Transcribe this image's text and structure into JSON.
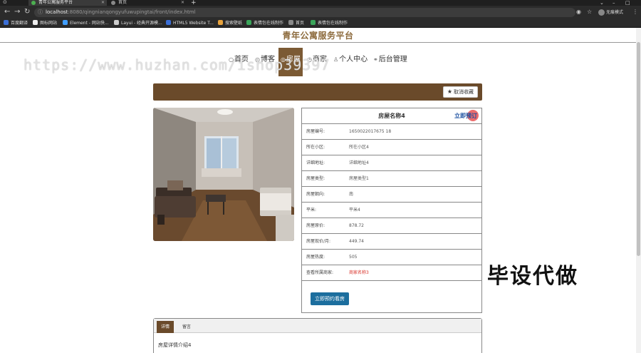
{
  "browser": {
    "tabs": [
      {
        "title": "青年公寓服务平台",
        "active": true
      },
      {
        "title": "首页",
        "active": false
      }
    ],
    "url_host": "localhost",
    "url_path": ":8080/qingnianqongyufuwupingtai/front/index.html",
    "profile_label": "无痕模式",
    "bookmarks": [
      {
        "label": "百度翻译",
        "color": "#3b6fd6"
      },
      {
        "label": "图标网站",
        "color": "#eeeeee"
      },
      {
        "label": "Element - 网站快...",
        "color": "#409eff"
      },
      {
        "label": "Layui - 经典开源模...",
        "color": "#cccccc"
      },
      {
        "label": "HTML5 Website T...",
        "color": "#3b6fd6"
      },
      {
        "label": "搜索壁纸",
        "color": "#e8a33d"
      },
      {
        "label": "表情包在线制作",
        "color": "#3aa55a"
      },
      {
        "label": "首页",
        "color": "#888888"
      },
      {
        "label": "表情包在线制作",
        "color": "#3aa55a"
      }
    ]
  },
  "site": {
    "title": "青年公寓服务平台",
    "menu": [
      {
        "label": "首页",
        "icon": "○",
        "active": false
      },
      {
        "label": "博客",
        "icon": "◎",
        "active": false
      },
      {
        "label": "房屋",
        "icon": "◎",
        "active": true
      },
      {
        "label": "商家",
        "icon": "◷",
        "active": false
      },
      {
        "label": "个人中心",
        "icon": "♙",
        "active": false
      },
      {
        "label": "后台管理",
        "icon": "⚭",
        "active": false
      }
    ],
    "favorite_button": "取消收藏",
    "watermark": "https://www.huzhan.com/ishop39397"
  },
  "house": {
    "name": "房屋名称4",
    "book_link": "立即预订",
    "rows": [
      {
        "label": "房屋编号:",
        "value": "1650022017675 18"
      },
      {
        "label": "所在小区:",
        "value": "所在小区4"
      },
      {
        "label": "详细地址:",
        "value": "详细地址4"
      },
      {
        "label": "房屋类型:",
        "value": "房屋类型1"
      },
      {
        "label": "房屋朝向:",
        "value": "南"
      },
      {
        "label": "平米:",
        "value": "平米4"
      },
      {
        "label": "房屋原价:",
        "value": "878.72"
      },
      {
        "label": "房屋现价/月:",
        "value": "449.74"
      },
      {
        "label": "房屋热度:",
        "value": "505"
      },
      {
        "label": "查看所属商家:",
        "value": "商家名称3"
      }
    ],
    "book_button": "立即预约看房",
    "tabs": [
      "详情",
      "留言"
    ],
    "intro": "房屋详情介绍4"
  },
  "overlay_text": "毕设代做"
}
